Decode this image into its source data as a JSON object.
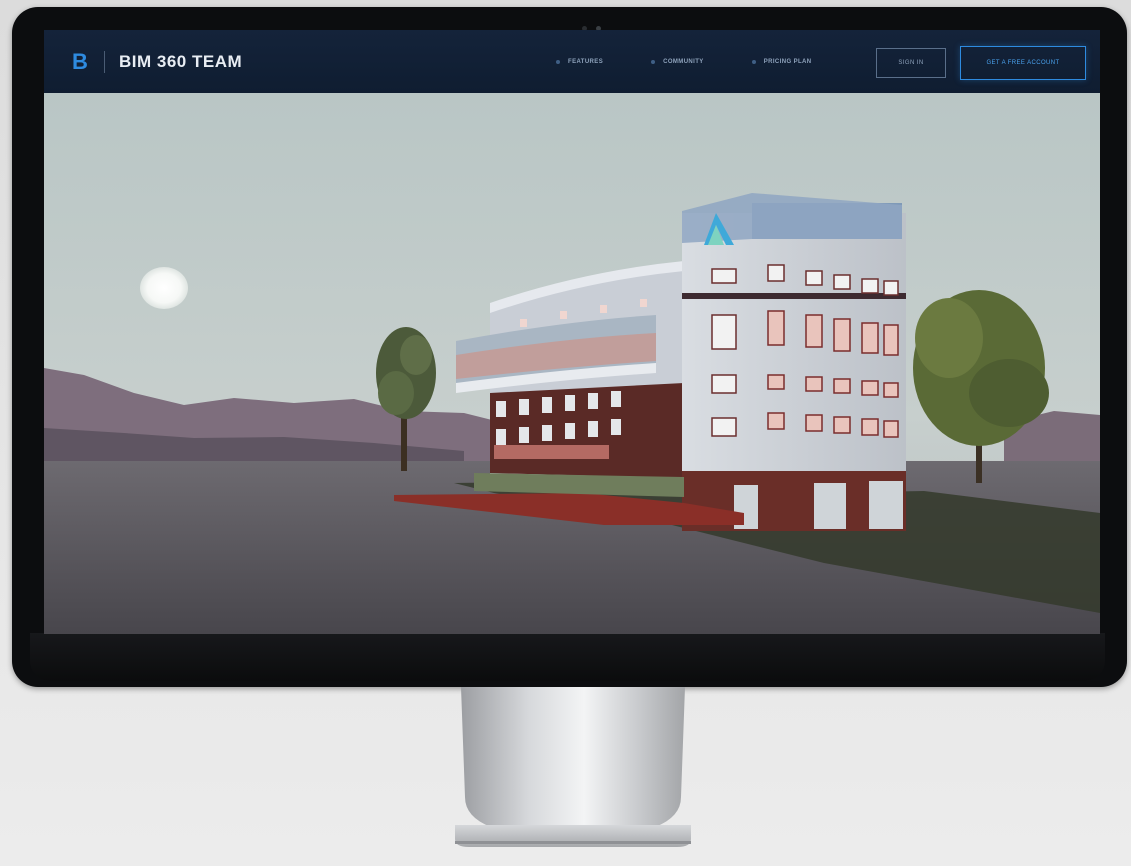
{
  "app": {
    "brand_mark": "B",
    "brand_name": "BIM 360 TEAM"
  },
  "nav": {
    "links": [
      {
        "label": "FEATURES"
      },
      {
        "label": "COMMUNITY"
      },
      {
        "label": "PRICING PLAN"
      }
    ],
    "sign_in_label": "SIGN IN",
    "account_label": "GET A FREE ACCOUNT"
  },
  "colors": {
    "nav_background": "#12213a",
    "accent": "#2e8be0",
    "bezel": "#0c0d0f"
  },
  "hero": {
    "scene": "building-render",
    "building_logo_icon": "autodesk-logo-icon"
  }
}
